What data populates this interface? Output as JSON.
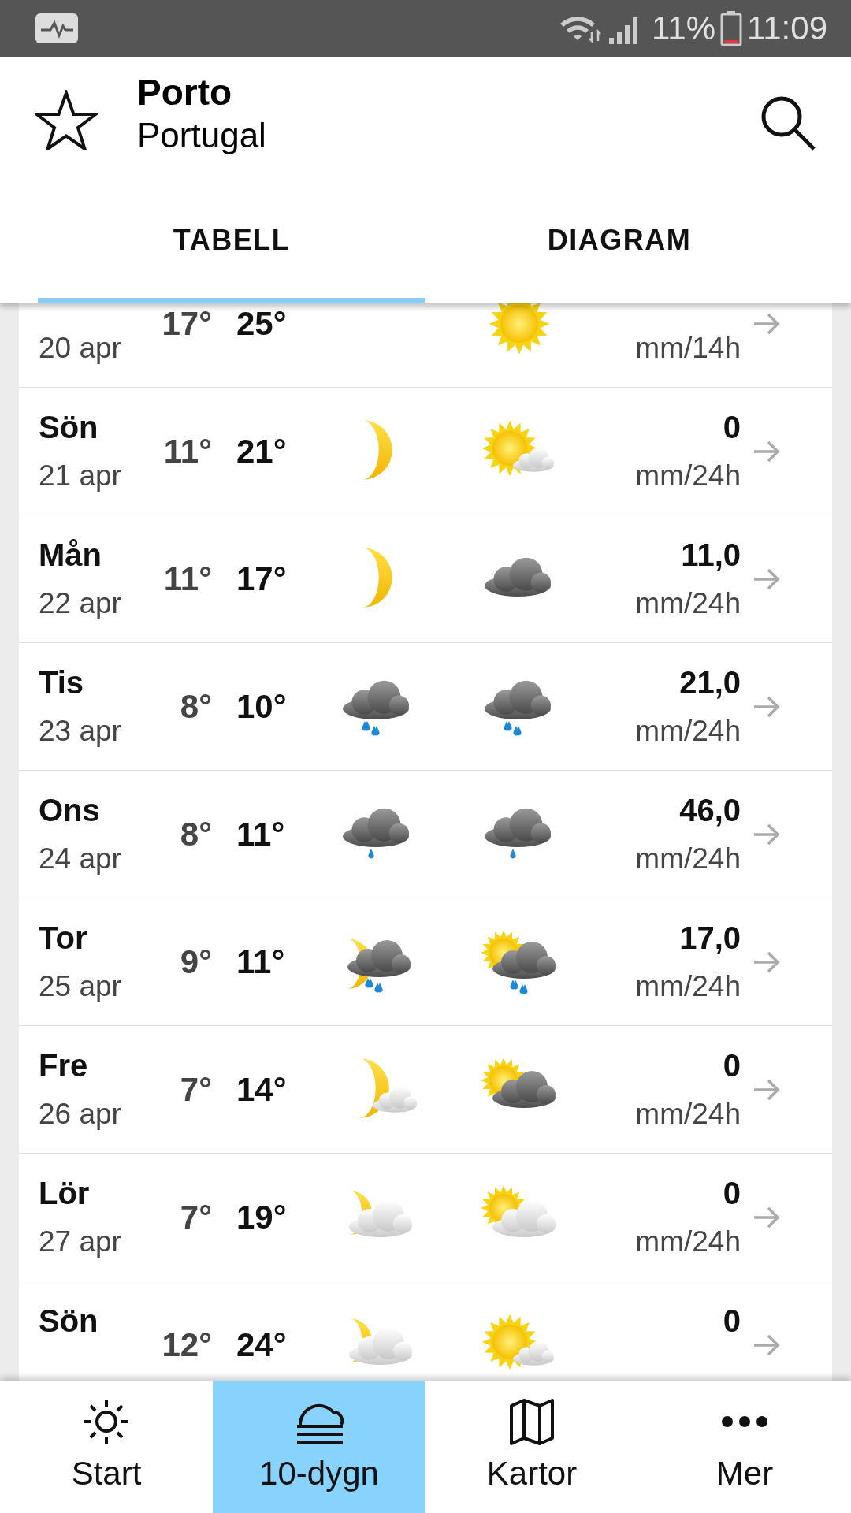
{
  "status_bar": {
    "battery": "11%",
    "time": "11:09"
  },
  "header": {
    "title": "Porto",
    "subtitle": "Portugal"
  },
  "tabs": [
    {
      "label": "TABELL",
      "selected": true
    },
    {
      "label": "DIAGRAM",
      "selected": false
    }
  ],
  "days": [
    {
      "date": "20 apr",
      "min": "17°",
      "max": "25°",
      "day_icon": {
        "kind": "sun"
      },
      "unit": "mm/14h"
    },
    {
      "day": "Sön",
      "date": "21 apr",
      "min": "11°",
      "max": "21°",
      "night_icon": {
        "kind": "moon"
      },
      "day_icon": {
        "kind": "sun_small_cloud"
      },
      "precip": "0",
      "unit": "mm/24h"
    },
    {
      "day": "Mån",
      "date": "22 apr",
      "min": "11°",
      "max": "17°",
      "night_icon": {
        "kind": "moon"
      },
      "day_icon": {
        "kind": "cloud"
      },
      "precip": "11,0",
      "unit": "mm/24h"
    },
    {
      "day": "Tis",
      "date": "23 apr",
      "min": "8°",
      "max": "10°",
      "night_icon": {
        "kind": "rain"
      },
      "day_icon": {
        "kind": "rain"
      },
      "precip": "21,0",
      "unit": "mm/24h"
    },
    {
      "day": "Ons",
      "date": "24 apr",
      "min": "8°",
      "max": "11°",
      "night_icon": {
        "kind": "light_rain"
      },
      "day_icon": {
        "kind": "light_rain"
      },
      "precip": "46,0",
      "unit": "mm/24h"
    },
    {
      "day": "Tor",
      "date": "25 apr",
      "min": "9°",
      "max": "11°",
      "night_icon": {
        "kind": "moon_rain"
      },
      "day_icon": {
        "kind": "sun_rain"
      },
      "precip": "17,0",
      "unit": "mm/24h"
    },
    {
      "day": "Fre",
      "date": "26 apr",
      "min": "7°",
      "max": "14°",
      "night_icon": {
        "kind": "moon_small_cloud"
      },
      "day_icon": {
        "kind": "sun_dark_cloud"
      },
      "precip": "0",
      "unit": "mm/24h"
    },
    {
      "day": "Lör",
      "date": "27 apr",
      "min": "7°",
      "max": "19°",
      "night_icon": {
        "kind": "moon_cloud"
      },
      "day_icon": {
        "kind": "sun_cloud"
      },
      "precip": "0",
      "unit": "mm/24h"
    },
    {
      "day": "Sön",
      "min": "12°",
      "max": "24°",
      "night_icon": {
        "kind": "moon_cloud"
      },
      "day_icon": {
        "kind": "sun_small_cloud"
      },
      "precip": "0"
    }
  ],
  "bottom_nav": [
    {
      "label": "Start",
      "kind": "sun",
      "selected": false
    },
    {
      "label": "10-dygn",
      "kind": "fog",
      "selected": true
    },
    {
      "label": "Kartor",
      "kind": "map",
      "selected": false
    },
    {
      "label": "Mer",
      "kind": "more",
      "selected": false
    }
  ]
}
